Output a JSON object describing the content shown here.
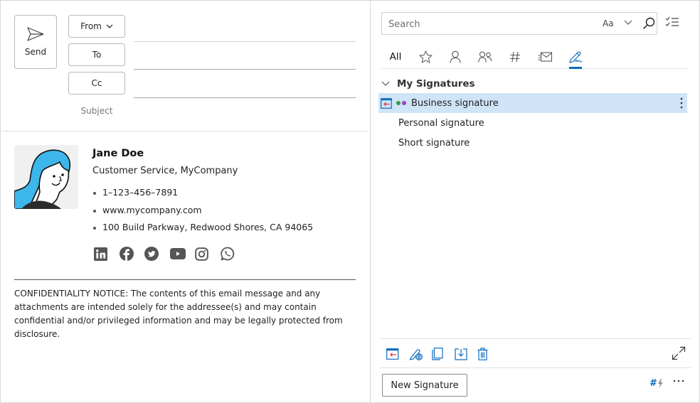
{
  "compose": {
    "send_label": "Send",
    "from_label": "From",
    "to_label": "To",
    "cc_label": "Cc",
    "subject_label": "Subject",
    "to_value": "",
    "cc_value": "",
    "subject_value": ""
  },
  "signature_preview": {
    "name": "Jane Doe",
    "title": "Customer Service, MyCompany",
    "contact_items": [
      "1–123–456–7891",
      "www.mycompany.com",
      "100 Build Parkway, Redwood Shores, CA 94065"
    ],
    "social_icons": [
      "linkedin-icon",
      "facebook-icon",
      "twitter-icon",
      "youtube-icon",
      "instagram-icon",
      "whatsapp-icon"
    ],
    "notice": "CONFIDENTIALITY NOTICE: The contents of this email message and any attachments are intended solely for the addressee(s) and may contain confidential and/or privileged information and may be legally protected from disclosure.",
    "avatar_colors": {
      "hair": "#3db6ec",
      "background": "#f0f0f0"
    }
  },
  "panel": {
    "search": {
      "placeholder": "Search",
      "value": "",
      "match_case_label": "Aa"
    },
    "tabs": [
      {
        "label": "All",
        "icon": null
      },
      {
        "label": "Favorites",
        "icon": "star-icon"
      },
      {
        "label": "Personal",
        "icon": "person-icon"
      },
      {
        "label": "Shared",
        "icon": "people-icon"
      },
      {
        "label": "Tags",
        "icon": "hash-icon"
      },
      {
        "label": "Templates",
        "icon": "mail-icon"
      },
      {
        "label": "Signatures",
        "icon": "signature-pen-icon",
        "active": true
      }
    ],
    "group_title": "My Signatures",
    "signatures": [
      {
        "name": "Business signature",
        "selected": true,
        "default": true,
        "color_dots": [
          "#3a9b46",
          "#a03fc2"
        ]
      },
      {
        "name": "Personal signature",
        "selected": false
      },
      {
        "name": "Short signature",
        "selected": false
      }
    ],
    "toolbar_icons": [
      "insert-signature-icon",
      "edit-signature-icon",
      "copy-icon",
      "import-icon",
      "delete-icon"
    ],
    "new_signature_label": "New Signature",
    "colors": {
      "accent": "#0f6cbd",
      "selected_row": "#cfe4f6",
      "insert_arrow": "#e0344b"
    }
  }
}
